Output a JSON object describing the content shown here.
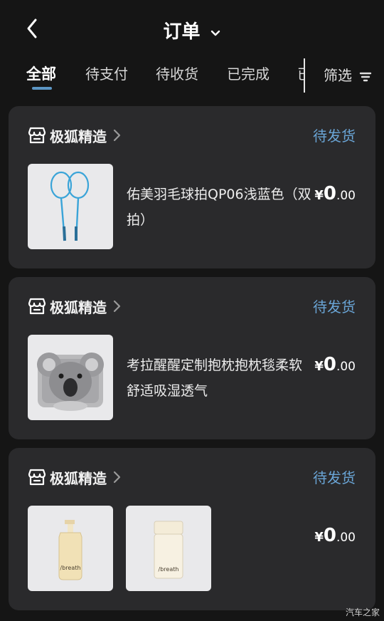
{
  "header": {
    "title": "订单"
  },
  "tabs": [
    {
      "label": "全部"
    },
    {
      "label": "待支付"
    },
    {
      "label": "待收货"
    },
    {
      "label": "已完成"
    },
    {
      "label": "已"
    }
  ],
  "filter": {
    "label": "筛选"
  },
  "orders": [
    {
      "shop": "极狐精造",
      "status": "待发货",
      "product": "佑美羽毛球拍QP06浅蓝色（双拍）",
      "price": {
        "currency": "¥",
        "integer": "0",
        "decimal": ".00"
      }
    },
    {
      "shop": "极狐精造",
      "status": "待发货",
      "product": "考拉醒醒定制抱枕抱枕毯柔软舒适吸湿透气",
      "price": {
        "currency": "¥",
        "integer": "0",
        "decimal": ".00"
      }
    },
    {
      "shop": "极狐精造",
      "status": "待发货",
      "product_labels": [
        "/breath",
        "/breath"
      ],
      "price": {
        "currency": "¥",
        "integer": "0",
        "decimal": ".00"
      }
    }
  ],
  "watermark": "汽车之家",
  "colors": {
    "background": "#151515",
    "card": "#2a2a2c",
    "accent": "#6aa5d6"
  }
}
